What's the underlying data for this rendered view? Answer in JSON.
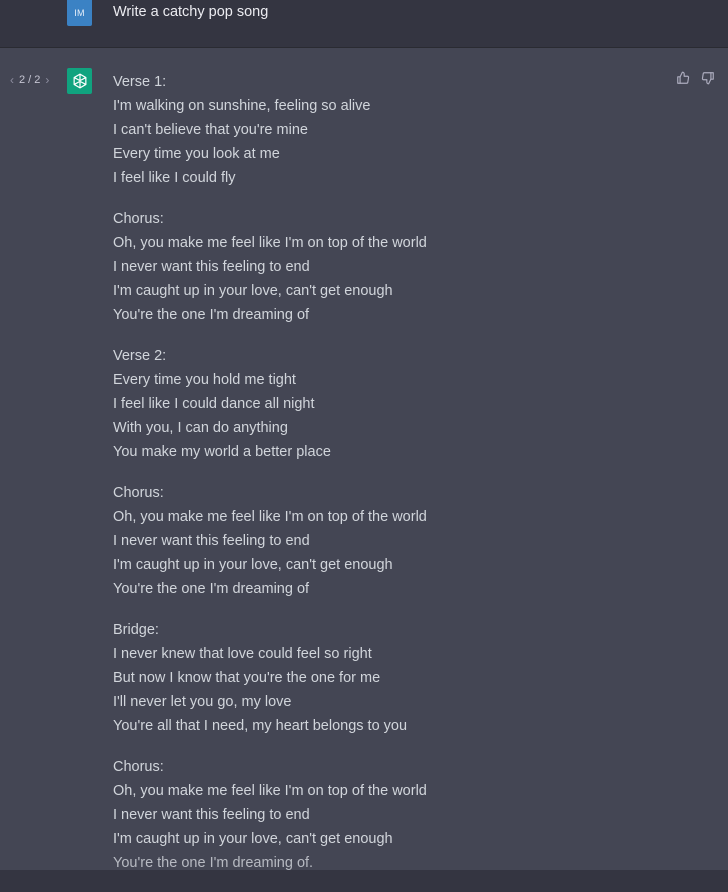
{
  "user": {
    "avatar_initials": "IM",
    "message": "Write a catchy pop song"
  },
  "assistant": {
    "pager": {
      "prev_icon": "‹",
      "count": "2 / 2",
      "next_icon": "›"
    },
    "stanzas": [
      {
        "heading": "Verse 1:",
        "lines": [
          "I'm walking on sunshine, feeling so alive",
          "I can't believe that you're mine",
          "Every time you look at me",
          "I feel like I could fly"
        ]
      },
      {
        "heading": "Chorus:",
        "lines": [
          "Oh, you make me feel like I'm on top of the world",
          "I never want this feeling to end",
          "I'm caught up in your love, can't get enough",
          "You're the one I'm dreaming of"
        ]
      },
      {
        "heading": "Verse 2:",
        "lines": [
          "Every time you hold me tight",
          "I feel like I could dance all night",
          "With you, I can do anything",
          "You make my world a better place"
        ]
      },
      {
        "heading": "Chorus:",
        "lines": [
          "Oh, you make me feel like I'm on top of the world",
          "I never want this feeling to end",
          "I'm caught up in your love, can't get enough",
          "You're the one I'm dreaming of"
        ]
      },
      {
        "heading": "Bridge:",
        "lines": [
          "I never knew that love could feel so right",
          "But now I know that you're the one for me",
          "I'll never let you go, my love",
          "You're all that I need, my heart belongs to you"
        ]
      },
      {
        "heading": "Chorus:",
        "lines": [
          "Oh, you make me feel like I'm on top of the world",
          "I never want this feeling to end",
          "I'm caught up in your love, can't get enough",
          "You're the one I'm dreaming of."
        ]
      }
    ]
  },
  "colors": {
    "user_bg": "#343541",
    "assistant_bg": "#444654",
    "gpt_green": "#10a37f",
    "user_avatar_blue": "#3b82c4"
  }
}
